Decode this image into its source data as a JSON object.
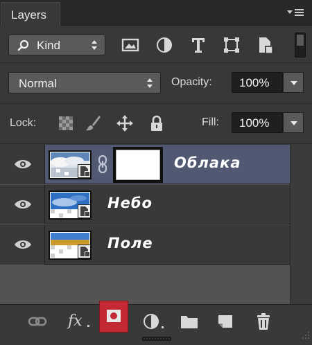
{
  "panel": {
    "tab_label": "Layers",
    "menu_icon": "panel-menu-icon"
  },
  "filter": {
    "kind_label": "Kind",
    "icons": [
      "image-filter-icon",
      "adjustment-filter-icon",
      "type-filter-icon",
      "shape-filter-icon",
      "smart-object-filter-icon"
    ]
  },
  "blend": {
    "mode": "Normal",
    "opacity_label": "Opacity:",
    "opacity_value": "100%"
  },
  "lock": {
    "label": "Lock:",
    "icons": [
      "lock-transparent-pixels-icon",
      "lock-image-pixels-icon",
      "lock-position-icon",
      "lock-all-icon"
    ],
    "fill_label": "Fill:",
    "fill_value": "100%"
  },
  "layers": [
    {
      "name": "Облака",
      "visible": true,
      "selected": true,
      "has_mask": true
    },
    {
      "name": "Небо",
      "visible": true,
      "selected": false,
      "has_mask": false
    },
    {
      "name": "Поле",
      "visible": true,
      "selected": false,
      "has_mask": false
    }
  ],
  "toolbar": {
    "buttons": [
      "link-layers-icon",
      "fx-icon",
      "add-mask-icon",
      "adjustment-layer-icon",
      "new-group-icon",
      "new-layer-icon",
      "delete-layer-icon"
    ],
    "fx_label": "fx",
    "highlighted": "add-mask-icon"
  },
  "colors": {
    "panel_bg": "#383838",
    "selected_layer": "#505872",
    "highlight": "#c42a34"
  }
}
